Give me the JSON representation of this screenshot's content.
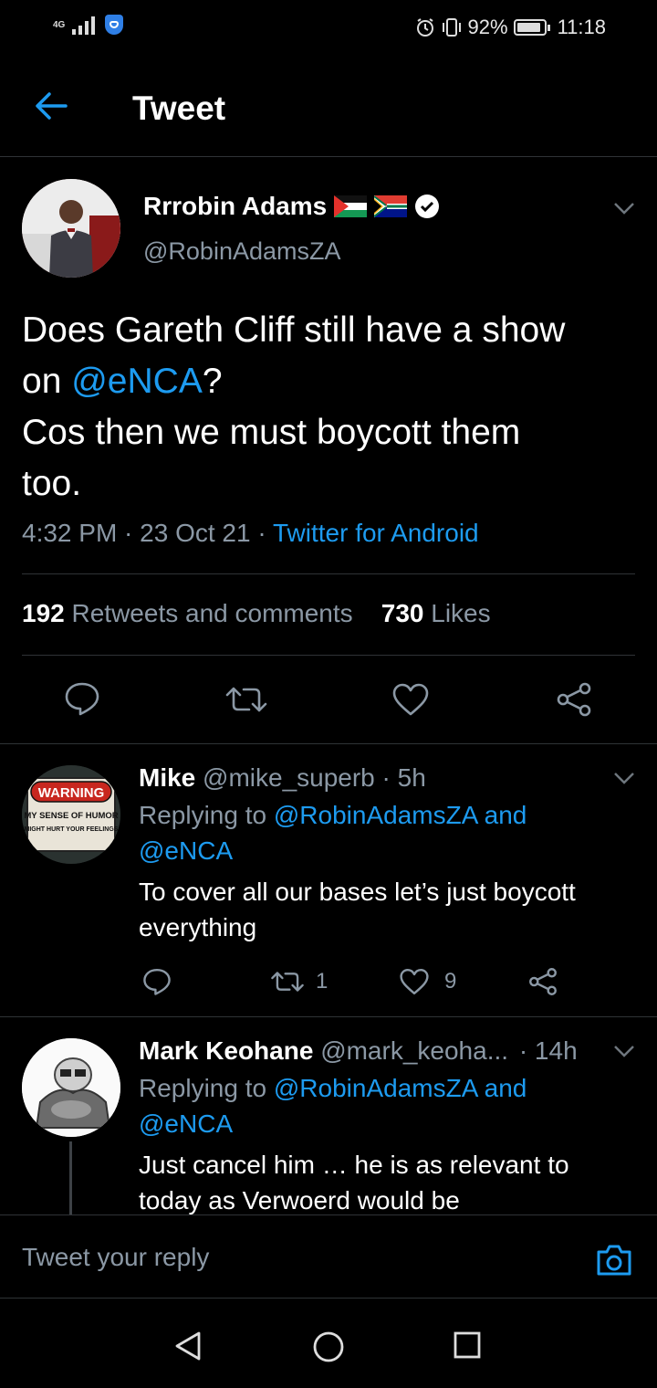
{
  "status_bar": {
    "network": "4G",
    "battery_percent": "92%",
    "battery_level": 0.92,
    "time": "11:18",
    "icons": [
      "signal-icon",
      "vpn-shield-icon",
      "alarm-icon",
      "vibrate-icon",
      "battery-icon"
    ]
  },
  "header": {
    "title": "Tweet",
    "back_icon": "back-arrow-icon"
  },
  "tweet": {
    "author_name": "Rrrobin Adams",
    "author_handle": "@RobinAdamsZA",
    "verified": true,
    "flags": [
      "palestine-flag",
      "south-africa-flag"
    ],
    "text_line1": "Does Gareth Cliff still have a show",
    "text_on": "on ",
    "mention": "@eNCA",
    "text_q": "?",
    "text_line3": "Cos then we must boycott them",
    "text_line4": "too.",
    "time": "4:32 PM",
    "date": "23 Oct 21",
    "source": "Twitter for Android",
    "retweets_count": "192",
    "retweets_label": "Retweets and comments",
    "likes_count": "730",
    "likes_label": "Likes"
  },
  "replies": [
    {
      "name": "Mike",
      "handle": "@mike_superb",
      "age": "5h",
      "replying_prefix": "Replying to",
      "replying_user1": "@RobinAdamsZA",
      "replying_and": "and",
      "replying_user2": "@eNCA",
      "text": "To cover all our bases let’s just boycott everything",
      "retweets": "1",
      "likes": "9",
      "avatar_sign_top": "WARNING",
      "avatar_sign_line1": "MY SENSE OF HUMOR",
      "avatar_sign_line2": "MIGHT HURT YOUR FEELINGS"
    },
    {
      "name": "Mark Keohane",
      "handle": "@mark_keoha...",
      "age": "14h",
      "replying_prefix": "Replying to",
      "replying_user1": "@RobinAdamsZA",
      "replying_and": "and",
      "replying_user2": "@eNCA",
      "text": "Just cancel him … he is as relevant to today as Verwoerd would be"
    }
  ],
  "composer": {
    "placeholder": "Tweet your reply"
  },
  "colors": {
    "background": "#000000",
    "accent": "#1d9bf0",
    "secondary_text": "#8b98a5",
    "divider": "#2f3336"
  }
}
